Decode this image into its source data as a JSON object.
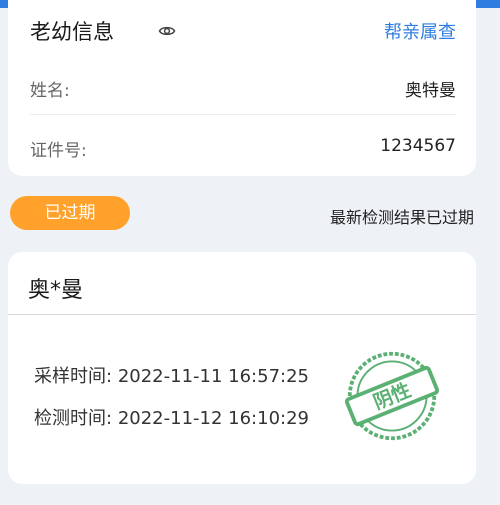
{
  "info_card": {
    "title": "老幼信息",
    "family_link": "帮亲属查",
    "name_label": "姓名:",
    "name_value": "奥特曼",
    "id_label": "证件号:",
    "id_value": "1234567"
  },
  "status": {
    "pill": "已过期",
    "message": "最新检测结果已过期"
  },
  "result_card": {
    "masked_name": "奥*曼",
    "sample_label": "采样时间:",
    "sample_time": "2022-11-11 16:57:25",
    "test_label": "检测时间:",
    "test_time": "2022-11-12 16:10:29",
    "stamp_text": "阴性"
  },
  "colors": {
    "accent": "#2f7de1",
    "warning": "#ffa12b",
    "stamp_green": "#3fa35b"
  }
}
